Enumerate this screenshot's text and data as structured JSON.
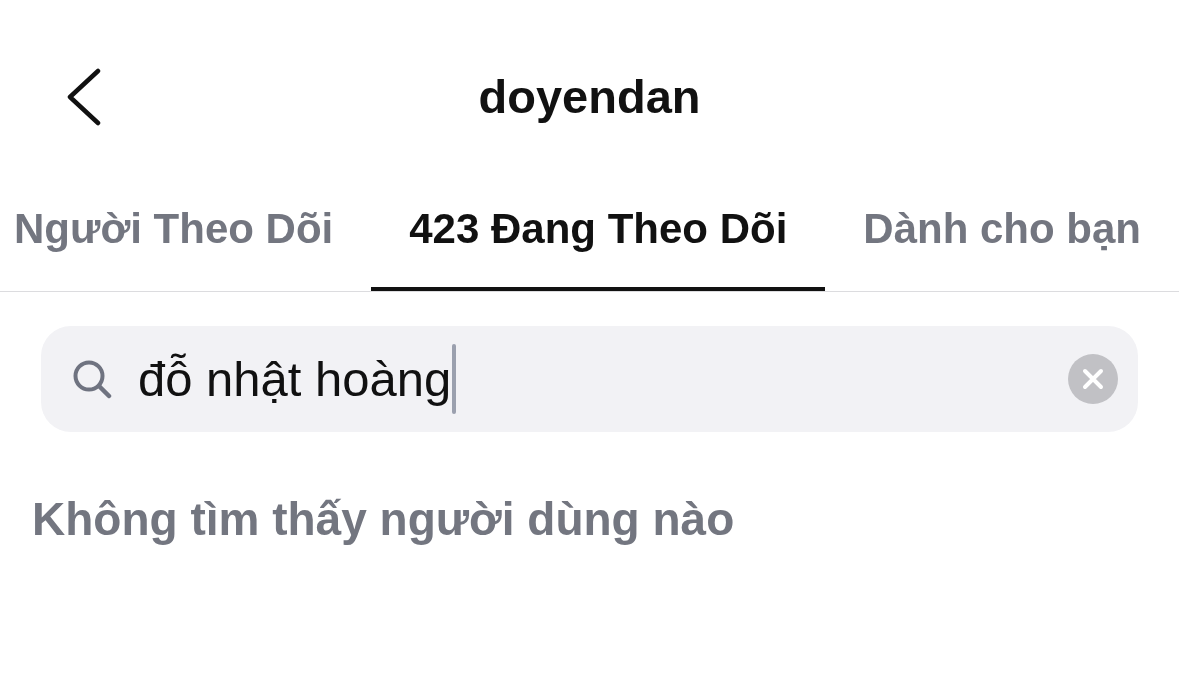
{
  "header": {
    "title": "doyendan"
  },
  "tabs": [
    {
      "label": "Người Theo Dõi",
      "selected": false
    },
    {
      "label": "423 Đang Theo Dõi",
      "selected": true
    },
    {
      "label": "Dành cho bạn",
      "selected": false
    }
  ],
  "search": {
    "value": "đỗ nhật hoàng",
    "focused": true
  },
  "empty_message": "Không tìm thấy người dùng nào"
}
